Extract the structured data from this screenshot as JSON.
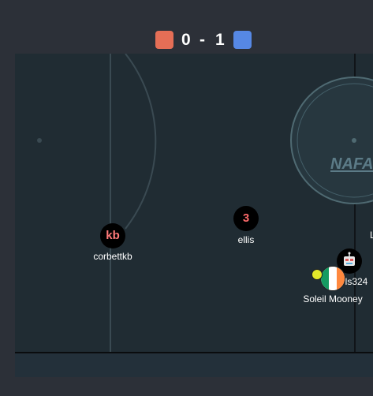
{
  "scoreboard": {
    "red_score": "0",
    "separator": "-",
    "blue_score": "1",
    "red_color": "#e56e56",
    "blue_color": "#5688e5"
  },
  "field": {
    "background": "#202c33",
    "logo_text": "NAFA"
  },
  "players": [
    {
      "name": "corbettkb",
      "avatar": "kb",
      "team": "red"
    },
    {
      "name": "ellis",
      "avatar": "3",
      "team": "red"
    },
    {
      "name": "ls324",
      "avatar": "robot-icon",
      "team": "blue"
    },
    {
      "name": "Soleil Mooney",
      "avatar": "ireland-flag-icon",
      "team": "blue"
    }
  ],
  "offscreen_label": "L"
}
